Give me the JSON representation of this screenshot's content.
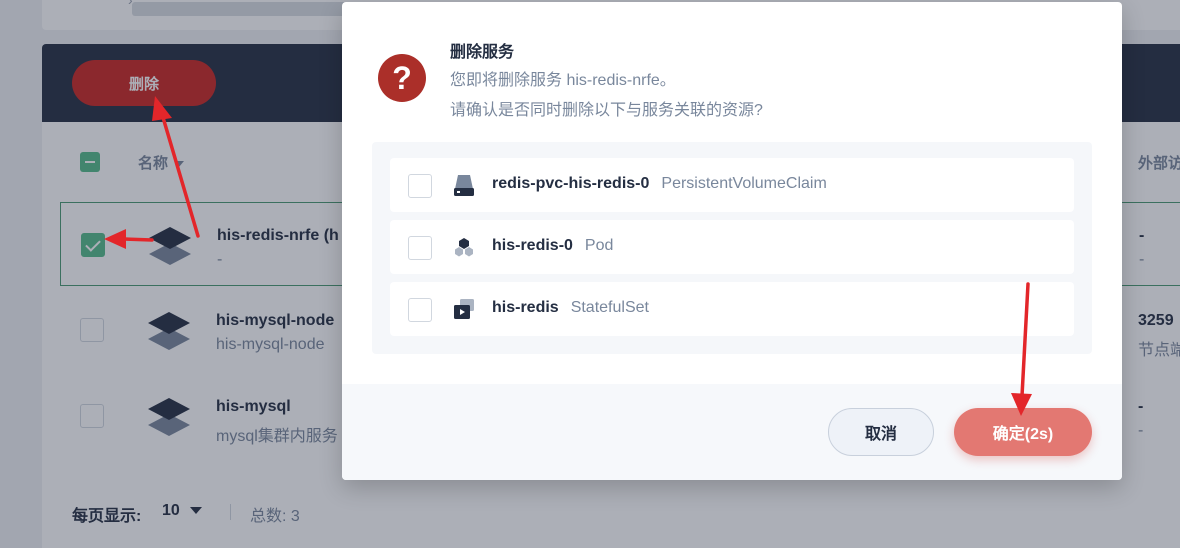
{
  "background": {
    "toolbar": {
      "delete_label": "删除"
    },
    "table_header": {
      "name_col": "名称",
      "ext_col": "外部访"
    },
    "rows": [
      {
        "title": "his-redis-nrfe (h",
        "subtitle": "-",
        "ext": "-",
        "ext_sub": "-",
        "checked": true
      },
      {
        "title": "his-mysql-node",
        "subtitle": "his-mysql-node",
        "ext": "3259",
        "ext_sub": "节点端",
        "checked": false
      },
      {
        "title": "his-mysql",
        "subtitle": "mysql集群内服务",
        "ext": "-",
        "ext_sub": "-",
        "checked": false
      }
    ],
    "pagination": {
      "per_page_label": "每页显示:",
      "per_page_value": "10",
      "total_label": "总数: 3"
    }
  },
  "modal": {
    "title": "删除服务",
    "desc_line1": "您即将删除服务 his-redis-nrfe。",
    "desc_line2": "请确认是否同时删除以下与服务关联的资源?",
    "resources": [
      {
        "name": "redis-pvc-his-redis-0",
        "type": "PersistentVolumeClaim",
        "icon": "volume-icon"
      },
      {
        "name": "his-redis-0",
        "type": "Pod",
        "icon": "pod-icon"
      },
      {
        "name": "his-redis",
        "type": "StatefulSet",
        "icon": "statefulset-icon"
      }
    ],
    "cancel_label": "取消",
    "confirm_label": "确定(2s)"
  },
  "colors": {
    "danger": "#ca2621",
    "success": "#55bc8a",
    "dark": "#242e42",
    "muted": "#79879c"
  }
}
